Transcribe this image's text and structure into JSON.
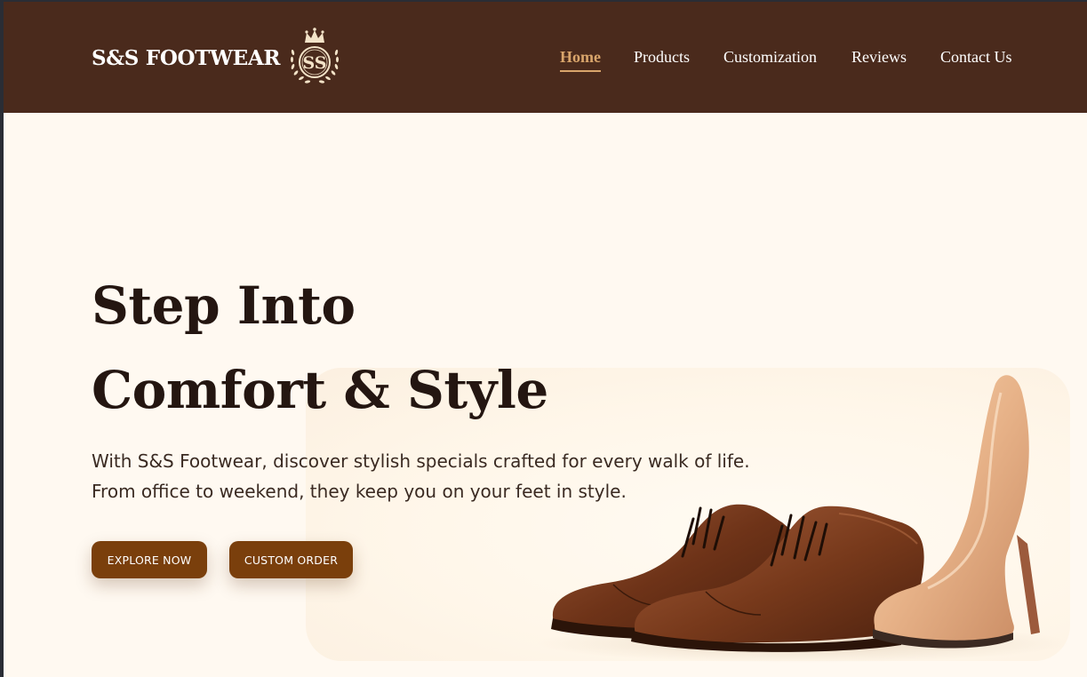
{
  "brand": {
    "name": "S&S FOOTWEAR",
    "logo_monogram": "SS"
  },
  "nav": [
    {
      "label": "Home",
      "active": true
    },
    {
      "label": "Products",
      "active": false
    },
    {
      "label": "Customization",
      "active": false
    },
    {
      "label": "Reviews",
      "active": false
    },
    {
      "label": "Contact Us",
      "active": false
    }
  ],
  "hero": {
    "title_line1": "Step Into",
    "title_line2": "Comfort & Style",
    "text_line1": "With S&S Footwear, discover stylish specials crafted for every walk of life.",
    "text_line2": "From office to weekend, they keep you on your feet in style.",
    "explore_label": "EXPLORE NOW",
    "custom_label": "CUSTOM ORDER"
  },
  "colors": {
    "header_bg": "#4a2a1c",
    "page_bg": "#fff9f1",
    "accent_gold": "#d9a56b",
    "button_brown": "#7a3f0c",
    "title_dark": "#241611"
  },
  "icons": {
    "logo": "crown-monogram-icon"
  }
}
